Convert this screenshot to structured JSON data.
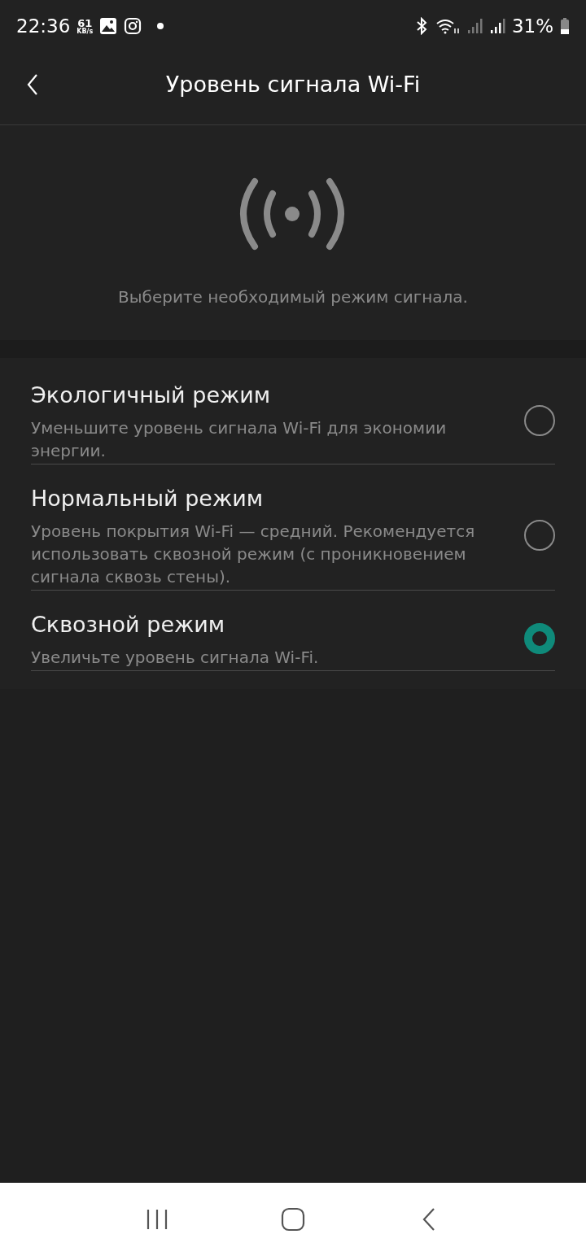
{
  "status_bar": {
    "time": "22:36",
    "speed_value": "61",
    "speed_unit": "KB/s",
    "battery": "31%"
  },
  "header": {
    "title": "Уровень сигнала Wi-Fi"
  },
  "hint": "Выберите необходимый режим сигнала.",
  "modes": [
    {
      "title": "Экологичный режим",
      "description": "Уменьшите уровень сигнала Wi-Fi для экономии энергии.",
      "selected": false
    },
    {
      "title": "Нормальный режим",
      "description": "Уровень покрытия Wi-Fi — средний. Рекомендуется использовать сквозной режим (с проникновением сигнала сквозь стены).",
      "selected": false
    },
    {
      "title": "Сквозной режим",
      "description": "Увеличьте уровень сигнала Wi-Fi.",
      "selected": true
    }
  ]
}
